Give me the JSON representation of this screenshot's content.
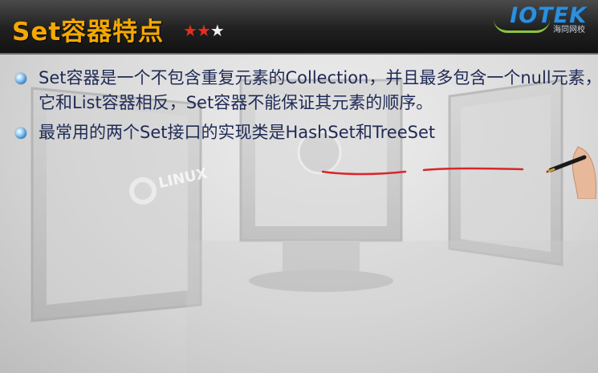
{
  "header": {
    "title": "Set容器特点",
    "stars": {
      "filled": 2,
      "total": 3,
      "filled_color": "#e0301e",
      "empty_color": "#f2f2f2"
    },
    "logo_text": "IOTEK",
    "logo_sub": "海同网校"
  },
  "background": {
    "watermark_text": "LINUX"
  },
  "bullets": [
    {
      "text": "Set容器是一个不包含重复元素的Collection，并且最多包含一个null元素，它和List容器相反，Set容器不能保证其元素的顺序。"
    },
    {
      "text": "最常用的两个Set接口的实现类是HashSet和TreeSet"
    }
  ],
  "colors": {
    "title": "#f5a800",
    "text": "#1f2a55",
    "underline": "#d9262a",
    "bullet": "#2a7fc9"
  },
  "icons": [
    "star-icon",
    "bullet-dot-icon",
    "pen-icon"
  ]
}
